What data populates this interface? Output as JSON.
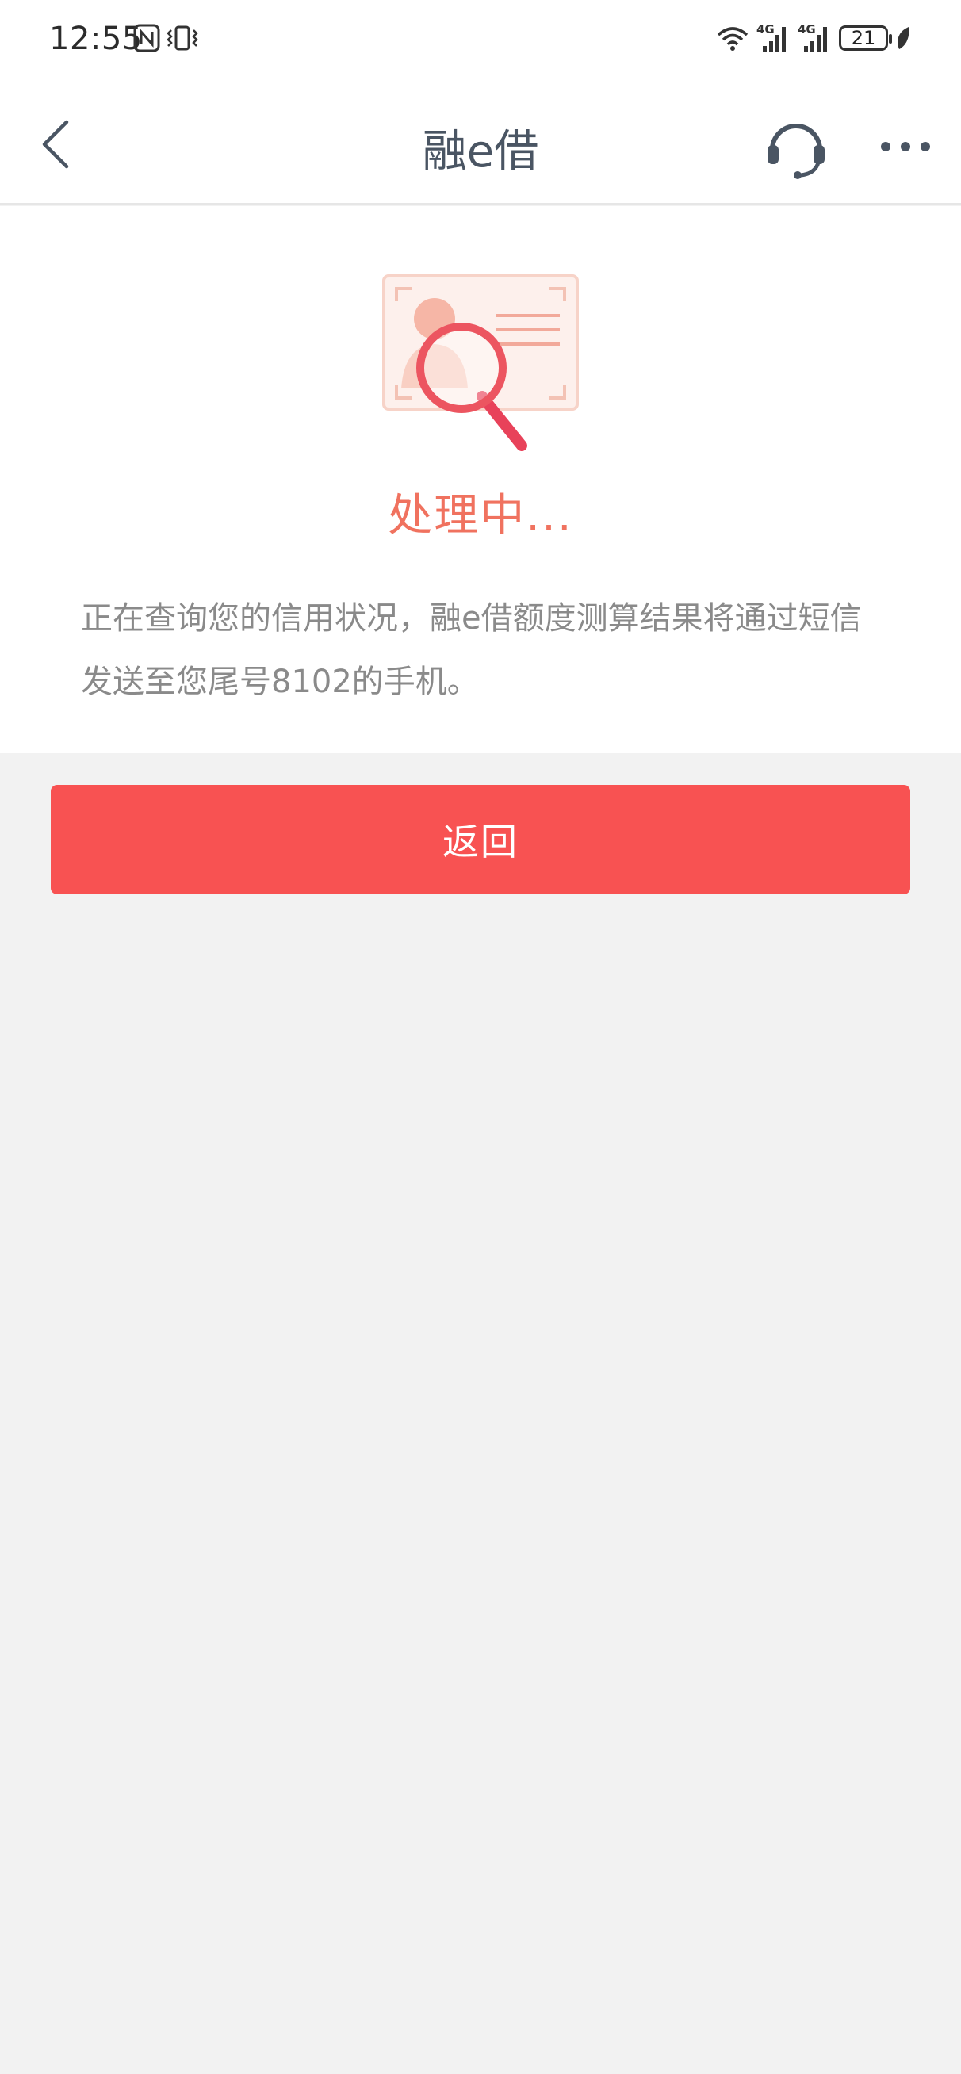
{
  "status_bar": {
    "time": "12:55",
    "battery": "21",
    "network_1": "4G",
    "network_2": "4G"
  },
  "header": {
    "title": "融e借",
    "back_icon": "chevron-left-icon",
    "support_icon": "headset-icon",
    "more_icon": "more-dots-icon"
  },
  "result": {
    "illustration": "credit-search-illustration",
    "status": "处理中...",
    "message": "正在查询您的信用状况，融e借额度测算结果将通过短信发送至您尾号8102的手机。"
  },
  "actions": {
    "return_label": "返回"
  },
  "colors": {
    "accent": "#f85252",
    "status_text": "#f0725f",
    "title_text": "#4a5563",
    "page_bg": "#f2f2f2"
  }
}
